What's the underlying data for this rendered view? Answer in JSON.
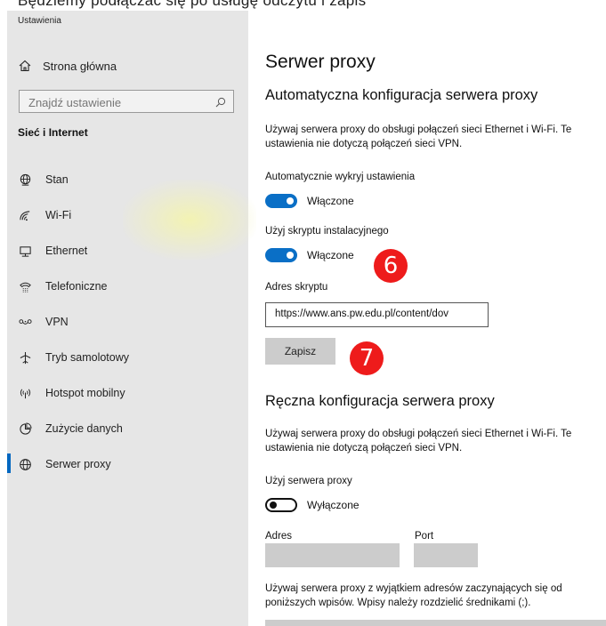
{
  "top_strip_text": "Będziemy podłączać się po usługę odczytu i zapis",
  "window_title": "Ustawienia",
  "home_label": "Strona główna",
  "search_placeholder": "Znajdź ustawienie",
  "section_title": "Sieć i Internet",
  "nav": [
    {
      "label": "Stan",
      "icon": "globe-stand-icon"
    },
    {
      "label": "Wi-Fi",
      "icon": "wifi-icon"
    },
    {
      "label": "Ethernet",
      "icon": "ethernet-icon"
    },
    {
      "label": "Telefoniczne",
      "icon": "dialup-icon"
    },
    {
      "label": "VPN",
      "icon": "vpn-icon"
    },
    {
      "label": "Tryb samolotowy",
      "icon": "airplane-icon"
    },
    {
      "label": "Hotspot mobilny",
      "icon": "hotspot-icon"
    },
    {
      "label": "Zużycie danych",
      "icon": "data-usage-icon"
    },
    {
      "label": "Serwer proxy",
      "icon": "globe-icon",
      "active": true
    }
  ],
  "main": {
    "title": "Serwer proxy",
    "auto_heading": "Automatyczna konfiguracja serwera proxy",
    "auto_desc": "Używaj serwera proxy do obsługi połączeń sieci Ethernet i Wi-Fi. Te ustawienia nie dotyczą połączeń sieci VPN.",
    "auto_detect_label": "Automatycznie wykryj ustawienia",
    "auto_detect_state": "Włączone",
    "script_label": "Użyj skryptu instalacyjnego",
    "script_state": "Włączone",
    "script_address_label": "Adres skryptu",
    "script_address_value": "https://www.ans.pw.edu.pl/content/dov",
    "save_label": "Zapisz",
    "badge_6": "6",
    "badge_7": "7",
    "manual_heading": "Ręczna konfiguracja serwera proxy",
    "manual_desc": "Używaj serwera proxy do obsługi połączeń sieci Ethernet i Wi-Fi. Te ustawienia nie dotyczą połączeń sieci VPN.",
    "use_proxy_label": "Użyj serwera proxy",
    "use_proxy_state": "Wyłączone",
    "address_label": "Adres",
    "port_label": "Port",
    "exceptions_desc": "Używaj serwera proxy z wyjątkiem adresów zaczynających się od poniższych wpisów. Wpisy należy rozdzielić średnikami (;)."
  },
  "colors": {
    "accent": "#0a6fc6",
    "badge": "#ee1b1b",
    "sidebar_bg": "#e6e6e6"
  }
}
